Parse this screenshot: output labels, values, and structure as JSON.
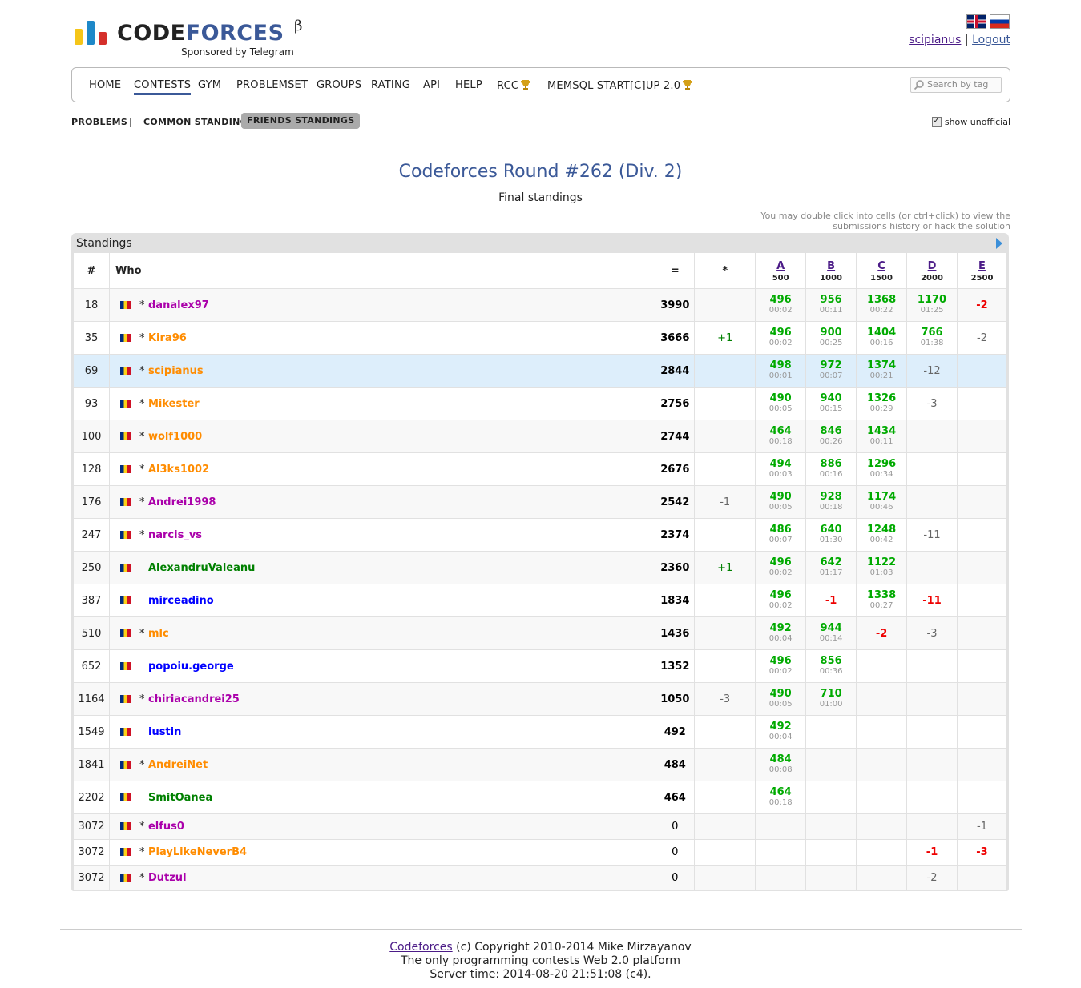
{
  "logo": {
    "word1": "CODE",
    "word2": "FORCES",
    "beta": "β",
    "sponsor": "Sponsored by Telegram"
  },
  "header": {
    "username": "scipianus",
    "separator": "|",
    "logout": "Logout"
  },
  "menu": {
    "items": [
      "HOME",
      "CONTESTS",
      "GYM",
      "PROBLEMSET",
      "GROUPS",
      "RATING",
      "API",
      "HELP",
      "RCC",
      "MEMSQL START[C]UP 2.0"
    ],
    "active": "CONTESTS",
    "search_placeholder": "Search by tag"
  },
  "submenu": {
    "problems": "PROBLEMS",
    "sep": "|",
    "common": "COMMON STANDINGS",
    "friends": "FRIENDS STANDINGS",
    "show_unofficial": "show unofficial"
  },
  "contest": {
    "title": "Codeforces Round #262 (Div. 2)",
    "subtitle": "Final standings",
    "hint_line1": "You may double click into cells (or ctrl+click) to view the",
    "hint_line2": "submissions history or hack the solution"
  },
  "standings": {
    "caption": "Standings",
    "headers": {
      "rank": "#",
      "who": "Who",
      "score": "=",
      "hacks": "*"
    },
    "problems": [
      {
        "letter": "A",
        "points": "500"
      },
      {
        "letter": "B",
        "points": "1000"
      },
      {
        "letter": "C",
        "points": "1500"
      },
      {
        "letter": "D",
        "points": "2000"
      },
      {
        "letter": "E",
        "points": "2500"
      }
    ],
    "rows": [
      {
        "rank": "18",
        "star": "*",
        "handle": "danalex97",
        "color": "purple",
        "score": "3990",
        "hacks": "",
        "cells": [
          [
            "496",
            "00:02"
          ],
          [
            "956",
            "00:11"
          ],
          [
            "1368",
            "00:22"
          ],
          [
            "1170",
            "01:25"
          ],
          [
            "-2",
            "red"
          ]
        ]
      },
      {
        "rank": "35",
        "star": "*",
        "handle": "Kira96",
        "color": "orange",
        "score": "3666",
        "hacks": "+1",
        "cells": [
          [
            "496",
            "00:02"
          ],
          [
            "900",
            "00:25"
          ],
          [
            "1404",
            "00:16"
          ],
          [
            "766",
            "01:38"
          ],
          [
            "-2",
            "grey"
          ]
        ]
      },
      {
        "rank": "69",
        "star": "*",
        "handle": "scipianus",
        "color": "orange",
        "score": "2844",
        "hacks": "",
        "highlight": true,
        "cells": [
          [
            "498",
            "00:01"
          ],
          [
            "972",
            "00:07"
          ],
          [
            "1374",
            "00:21"
          ],
          [
            "-12",
            "grey"
          ],
          null
        ]
      },
      {
        "rank": "93",
        "star": "*",
        "handle": "Mikester",
        "color": "orange",
        "score": "2756",
        "hacks": "",
        "cells": [
          [
            "490",
            "00:05"
          ],
          [
            "940",
            "00:15"
          ],
          [
            "1326",
            "00:29"
          ],
          [
            "-3",
            "grey"
          ],
          null
        ]
      },
      {
        "rank": "100",
        "star": "*",
        "handle": "wolf1000",
        "color": "orange",
        "score": "2744",
        "hacks": "",
        "cells": [
          [
            "464",
            "00:18"
          ],
          [
            "846",
            "00:26"
          ],
          [
            "1434",
            "00:11"
          ],
          null,
          null
        ]
      },
      {
        "rank": "128",
        "star": "*",
        "handle": "Al3ks1002",
        "color": "orange",
        "score": "2676",
        "hacks": "",
        "cells": [
          [
            "494",
            "00:03"
          ],
          [
            "886",
            "00:16"
          ],
          [
            "1296",
            "00:34"
          ],
          null,
          null
        ]
      },
      {
        "rank": "176",
        "star": "*",
        "handle": "Andrei1998",
        "color": "purple",
        "score": "2542",
        "hacks": "-1",
        "cells": [
          [
            "490",
            "00:05"
          ],
          [
            "928",
            "00:18"
          ],
          [
            "1174",
            "00:46"
          ],
          null,
          null
        ]
      },
      {
        "rank": "247",
        "star": "*",
        "handle": "narcis_vs",
        "color": "purple",
        "score": "2374",
        "hacks": "",
        "cells": [
          [
            "486",
            "00:07"
          ],
          [
            "640",
            "01:30"
          ],
          [
            "1248",
            "00:42"
          ],
          [
            "-11",
            "grey"
          ],
          null
        ]
      },
      {
        "rank": "250",
        "star": "",
        "handle": "AlexandruValeanu",
        "color": "green",
        "score": "2360",
        "hacks": "+1",
        "cells": [
          [
            "496",
            "00:02"
          ],
          [
            "642",
            "01:17"
          ],
          [
            "1122",
            "01:03"
          ],
          null,
          null
        ]
      },
      {
        "rank": "387",
        "star": "",
        "handle": "mirceadino",
        "color": "blue",
        "score": "1834",
        "hacks": "",
        "cells": [
          [
            "496",
            "00:02"
          ],
          [
            "-1",
            "red"
          ],
          [
            "1338",
            "00:27"
          ],
          [
            "-11",
            "red"
          ],
          null
        ]
      },
      {
        "rank": "510",
        "star": "*",
        "handle": "mlc",
        "color": "orange",
        "score": "1436",
        "hacks": "",
        "cells": [
          [
            "492",
            "00:04"
          ],
          [
            "944",
            "00:14"
          ],
          [
            "-2",
            "red"
          ],
          [
            "-3",
            "grey"
          ],
          null
        ]
      },
      {
        "rank": "652",
        "star": "",
        "handle": "popoiu.george",
        "color": "blue",
        "score": "1352",
        "hacks": "",
        "cells": [
          [
            "496",
            "00:02"
          ],
          [
            "856",
            "00:36"
          ],
          null,
          null,
          null
        ]
      },
      {
        "rank": "1164",
        "star": "*",
        "handle": "chiriacandrei25",
        "color": "purple",
        "score": "1050",
        "hacks": "-3",
        "cells": [
          [
            "490",
            "00:05"
          ],
          [
            "710",
            "01:00"
          ],
          null,
          null,
          null
        ]
      },
      {
        "rank": "1549",
        "star": "",
        "handle": "iustin",
        "color": "blue",
        "score": "492",
        "hacks": "",
        "cells": [
          [
            "492",
            "00:04"
          ],
          null,
          null,
          null,
          null
        ]
      },
      {
        "rank": "1841",
        "star": "*",
        "handle": "AndreiNet",
        "color": "orange",
        "score": "484",
        "hacks": "",
        "cells": [
          [
            "484",
            "00:08"
          ],
          null,
          null,
          null,
          null
        ]
      },
      {
        "rank": "2202",
        "star": "",
        "handle": "SmitOanea",
        "color": "green",
        "score": "464",
        "hacks": "",
        "cells": [
          [
            "464",
            "00:18"
          ],
          null,
          null,
          null,
          null
        ]
      },
      {
        "rank": "3072",
        "star": "*",
        "handle": "elfus0",
        "color": "purple",
        "score": "0",
        "hacks": "",
        "short": true,
        "cells": [
          null,
          null,
          null,
          null,
          [
            "-1",
            "grey"
          ]
        ]
      },
      {
        "rank": "3072",
        "star": "*",
        "handle": "PlayLikeNeverB4",
        "color": "orange",
        "score": "0",
        "hacks": "",
        "short": true,
        "cells": [
          null,
          null,
          null,
          [
            "-1",
            "red"
          ],
          [
            "-3",
            "red"
          ]
        ]
      },
      {
        "rank": "3072",
        "star": "*",
        "handle": "Dutzul",
        "color": "purple",
        "score": "0",
        "hacks": "",
        "short": true,
        "cells": [
          null,
          null,
          null,
          [
            "-2",
            "grey"
          ],
          null
        ]
      }
    ]
  },
  "footer": {
    "link": "Codeforces",
    "copyright": " (c) Copyright 2010-2014 Mike Mirzayanov",
    "line2": "The only programming contests Web 2.0 platform",
    "line3": "Server time: 2014-08-20 21:51:08 (c4)."
  }
}
